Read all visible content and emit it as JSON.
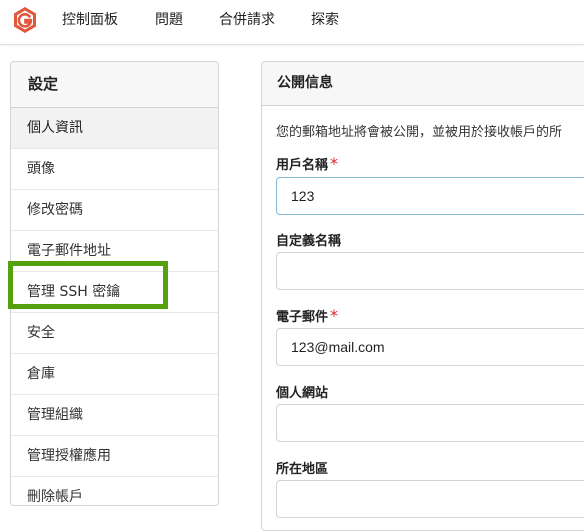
{
  "nav": {
    "items": [
      "控制面板",
      "問題",
      "合併請求",
      "探索"
    ]
  },
  "sidebar": {
    "title": "設定",
    "items": [
      "個人資訊",
      "頭像",
      "修改密碼",
      "電子郵件地址",
      "管理 SSH 密鑰",
      "安全",
      "倉庫",
      "管理組織",
      "管理授權應用",
      "刪除帳戶"
    ],
    "active_index": 0,
    "highlighted_index": 4
  },
  "panel": {
    "title": "公開信息",
    "notice": "您的郵箱地址將會被公開，並被用於接收帳戶的所",
    "fields": {
      "username": {
        "label": "用戶名稱",
        "required": "*",
        "value": "123"
      },
      "fullname": {
        "label": "自定義名稱",
        "value": ""
      },
      "email": {
        "label": "電子郵件",
        "required": "*",
        "value": "123@mail.com"
      },
      "website": {
        "label": "個人網站",
        "value": ""
      },
      "location": {
        "label": "所在地區",
        "value": ""
      }
    }
  },
  "colors": {
    "highlight": "#54a00d",
    "logo": "#e0573a",
    "required": "#db2828"
  }
}
